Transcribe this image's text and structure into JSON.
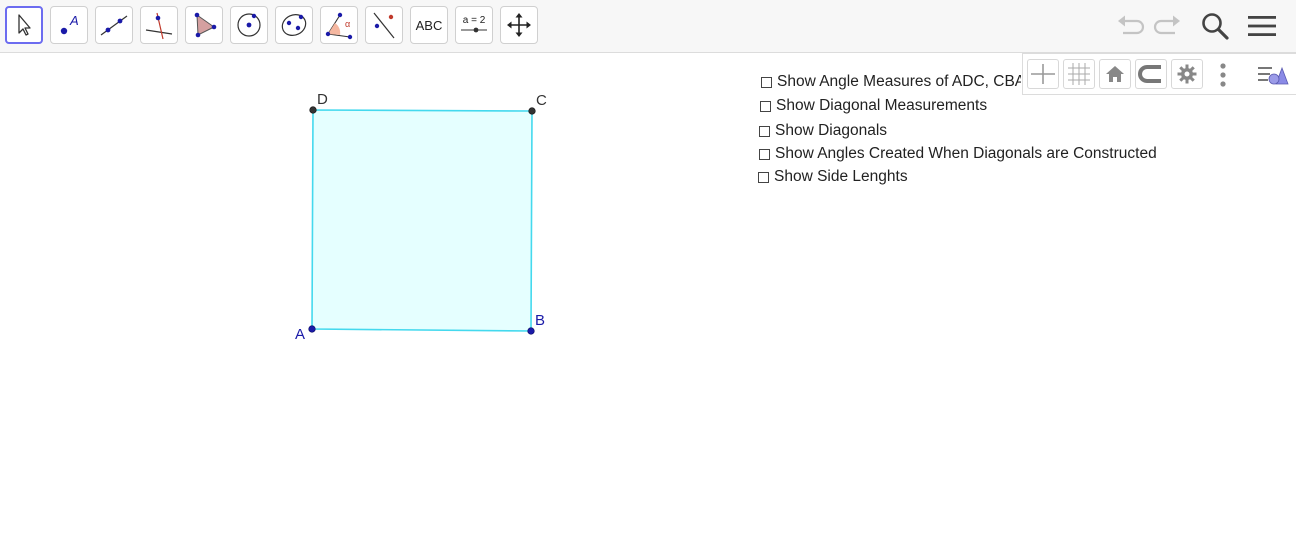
{
  "toolbar": {
    "tools": [
      {
        "name": "move-tool",
        "icon": "cursor-arrow-icon"
      },
      {
        "name": "point-tool",
        "icon": "point-icon",
        "label": "A"
      },
      {
        "name": "line-tool",
        "icon": "line-icon"
      },
      {
        "name": "perpendicular-tool",
        "icon": "perpendicular-line-icon"
      },
      {
        "name": "polygon-tool",
        "icon": "polygon-icon"
      },
      {
        "name": "circle-tool",
        "icon": "circle-center-icon"
      },
      {
        "name": "ellipse-tool",
        "icon": "ellipse-icon"
      },
      {
        "name": "angle-tool",
        "icon": "angle-icon",
        "label": "α"
      },
      {
        "name": "reflect-tool",
        "icon": "reflect-about-line-icon"
      },
      {
        "name": "text-tool",
        "icon": "text-icon",
        "label": "ABC"
      },
      {
        "name": "slider-tool",
        "icon": "slider-icon",
        "label": "a = 2"
      },
      {
        "name": "move-graphics-tool",
        "icon": "move-arrows-icon"
      }
    ],
    "selected_tool": "move-tool",
    "undo_icon": "undo-icon",
    "redo_icon": "redo-icon",
    "search_icon": "search-icon",
    "menu_icon": "hamburger-menu-icon"
  },
  "stylebar": {
    "buttons": [
      "axes-icon",
      "grid-icon",
      "home-icon",
      "point-capturing-icon",
      "gear-icon",
      "more-vertical-icon"
    ],
    "toggle_icon": "style-bar-toggle-icon"
  },
  "checkboxes": [
    {
      "label": "Show Angle Measures of ADC, CBA",
      "checked": false
    },
    {
      "label": "Show Diagonal Measurements",
      "checked": false
    },
    {
      "label": "Show Diagonals",
      "checked": false
    },
    {
      "label": "Show Angles Created When Diagonals are Constructed",
      "checked": false
    },
    {
      "label": "Show Side Lenghts",
      "checked": false
    }
  ],
  "geometry": {
    "fill_color": "#e5ffff",
    "stroke_color": "#44d9ee",
    "points": [
      {
        "label": "A",
        "color": "#1a1aa8"
      },
      {
        "label": "B",
        "color": "#1a1aa8"
      },
      {
        "label": "C",
        "color": "#333333"
      },
      {
        "label": "D",
        "color": "#333333"
      }
    ]
  }
}
